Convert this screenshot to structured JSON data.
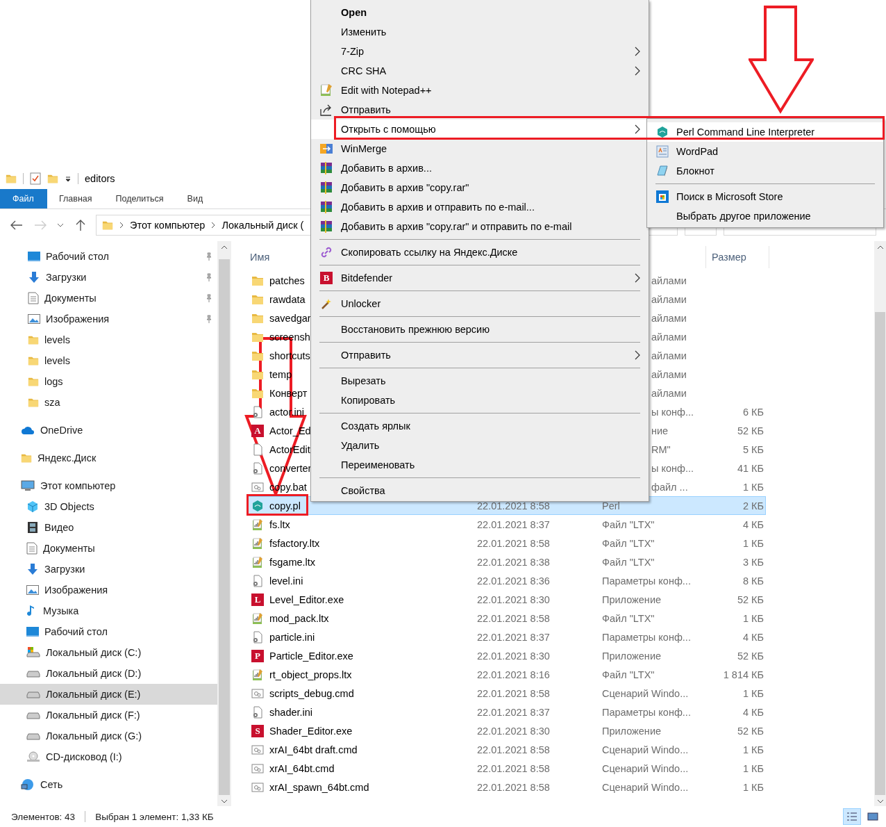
{
  "title_bar": {
    "title": "editors"
  },
  "ribbon": {
    "tabs": [
      {
        "label": "Файл",
        "kind": "file",
        "selected": false
      },
      {
        "label": "Главная",
        "kind": "tab",
        "selected": false
      },
      {
        "label": "Поделиться",
        "kind": "tab",
        "selected": false
      },
      {
        "label": "Вид",
        "kind": "tab",
        "selected": false
      }
    ]
  },
  "address": {
    "crumbs": [
      "Этот компьютер",
      "Локальный диск ("
    ]
  },
  "quick_access": [
    {
      "label": "Рабочий стол",
      "kind": "desktop",
      "pinned": true,
      "selected": false
    },
    {
      "label": "Загрузки",
      "kind": "download",
      "pinned": true,
      "selected": false
    },
    {
      "label": "Документы",
      "kind": "docs",
      "pinned": true,
      "selected": false
    },
    {
      "label": "Изображения",
      "kind": "images",
      "pinned": true,
      "selected": false
    },
    {
      "label": "levels",
      "kind": "folder",
      "pinned": false,
      "selected": false
    },
    {
      "label": "levels",
      "kind": "folder",
      "pinned": false,
      "selected": false
    },
    {
      "label": "logs",
      "kind": "folder",
      "pinned": false,
      "selected": false
    },
    {
      "label": "sza",
      "kind": "folder",
      "pinned": false,
      "selected": false
    }
  ],
  "nav": [
    {
      "label": "OneDrive",
      "kind": "cloud",
      "selected": false
    },
    {
      "label": "Яндекс.Диск",
      "kind": "folder",
      "selected": false
    },
    {
      "label": "Этот компьютер",
      "kind": "computer",
      "selected": false,
      "children": [
        {
          "label": "3D Objects",
          "kind": "cube",
          "selected": false
        },
        {
          "label": "Видео",
          "kind": "video",
          "selected": false
        },
        {
          "label": "Документы",
          "kind": "docs",
          "selected": false
        },
        {
          "label": "Загрузки",
          "kind": "download",
          "selected": false
        },
        {
          "label": "Изображения",
          "kind": "images",
          "selected": false
        },
        {
          "label": "Музыка",
          "kind": "music",
          "selected": false
        },
        {
          "label": "Рабочий стол",
          "kind": "desktop",
          "selected": false
        },
        {
          "label": "Локальный диск (C:)",
          "kind": "system-drive",
          "selected": false
        },
        {
          "label": "Локальный диск (D:)",
          "kind": "drive",
          "selected": false
        },
        {
          "label": "Локальный диск (E:)",
          "kind": "drive",
          "selected": true
        },
        {
          "label": "Локальный диск (F:)",
          "kind": "drive",
          "selected": false
        },
        {
          "label": "Локальный диск (G:)",
          "kind": "drive",
          "selected": false
        },
        {
          "label": "CD-дисковод (I:)",
          "kind": "cd",
          "selected": false
        }
      ]
    },
    {
      "label": "Сеть",
      "kind": "network",
      "selected": false
    }
  ],
  "columns": {
    "name": "Имя",
    "size": "Размер"
  },
  "files": [
    {
      "name": "patches",
      "kind": "folder",
      "type": "айлами",
      "type_clipped": true,
      "selected": false
    },
    {
      "name": "rawdata",
      "kind": "folder",
      "type": "айлами",
      "type_clipped": true,
      "selected": false
    },
    {
      "name": "savedgar",
      "kind": "folder",
      "type": "айлами",
      "type_clipped": true,
      "selected": false
    },
    {
      "name": "screensh",
      "kind": "folder",
      "type": "айлами",
      "type_clipped": true,
      "selected": false
    },
    {
      "name": "shortcuts",
      "kind": "folder",
      "type": "айлами",
      "type_clipped": true,
      "selected": false
    },
    {
      "name": "temp",
      "kind": "folder",
      "type": "айлами",
      "type_clipped": true,
      "selected": false
    },
    {
      "name": "Конверт",
      "kind": "folder",
      "type": "айлами",
      "type_clipped": true,
      "selected": false
    },
    {
      "name": "actor.ini",
      "kind": "settings",
      "type": "ы конф...",
      "type_clipped": true,
      "size": "6 КБ",
      "selected": false
    },
    {
      "name": "Actor_Ed",
      "kind": "app",
      "badge": "A",
      "type": "ние",
      "type_clipped": true,
      "size": "52 КБ",
      "selected": false
    },
    {
      "name": "ActorEdit",
      "kind": "file",
      "type": "RM\"",
      "type_clipped": true,
      "size": "5 КБ",
      "selected": false
    },
    {
      "name": "converter",
      "kind": "settings",
      "type": "ы конф...",
      "type_clipped": true,
      "size": "41 КБ",
      "selected": false
    },
    {
      "name": "copy.bat",
      "kind": "script",
      "type": "файл ...",
      "type_clipped": true,
      "size": "1 КБ",
      "selected": false
    },
    {
      "name": "copy.pl",
      "kind": "perl",
      "date": "22.01.2021 8:58",
      "type": "Perl",
      "type_clipped": false,
      "size": "2 КБ",
      "selected": true
    },
    {
      "name": "fs.ltx",
      "kind": "ltx",
      "date": "22.01.2021 8:37",
      "type": "Файл \"LTX\"",
      "type_clipped": false,
      "size": "4 КБ",
      "selected": false
    },
    {
      "name": "fsfactory.ltx",
      "kind": "ltx",
      "date": "22.01.2021 8:58",
      "type": "Файл \"LTX\"",
      "type_clipped": false,
      "size": "1 КБ",
      "selected": false
    },
    {
      "name": "fsgame.ltx",
      "kind": "ltx",
      "date": "22.01.2021 8:38",
      "type": "Файл \"LTX\"",
      "type_clipped": false,
      "size": "3 КБ",
      "selected": false
    },
    {
      "name": "level.ini",
      "kind": "settings",
      "date": "22.01.2021 8:36",
      "type": "Параметры конф...",
      "type_clipped": false,
      "size": "8 КБ",
      "selected": false
    },
    {
      "name": "Level_Editor.exe",
      "kind": "app",
      "badge": "L",
      "date": "22.01.2021 8:30",
      "type": "Приложение",
      "type_clipped": false,
      "size": "52 КБ",
      "selected": false
    },
    {
      "name": "mod_pack.ltx",
      "kind": "ltx",
      "date": "22.01.2021 8:58",
      "type": "Файл \"LTX\"",
      "type_clipped": false,
      "size": "1 КБ",
      "selected": false
    },
    {
      "name": "particle.ini",
      "kind": "settings",
      "date": "22.01.2021 8:37",
      "type": "Параметры конф...",
      "type_clipped": false,
      "size": "4 КБ",
      "selected": false
    },
    {
      "name": "Particle_Editor.exe",
      "kind": "app",
      "badge": "P",
      "date": "22.01.2021 8:30",
      "type": "Приложение",
      "type_clipped": false,
      "size": "52 КБ",
      "selected": false
    },
    {
      "name": "rt_object_props.ltx",
      "kind": "ltx",
      "date": "22.01.2021 8:16",
      "type": "Файл \"LTX\"",
      "type_clipped": false,
      "size": "1 814 КБ",
      "selected": false
    },
    {
      "name": "scripts_debug.cmd",
      "kind": "script",
      "date": "22.01.2021 8:58",
      "type": "Сценарий Windo...",
      "type_clipped": false,
      "size": "1 КБ",
      "selected": false
    },
    {
      "name": "shader.ini",
      "kind": "settings",
      "date": "22.01.2021 8:37",
      "type": "Параметры конф...",
      "type_clipped": false,
      "size": "4 КБ",
      "selected": false
    },
    {
      "name": "Shader_Editor.exe",
      "kind": "app",
      "badge": "S",
      "date": "22.01.2021 8:30",
      "type": "Приложение",
      "type_clipped": false,
      "size": "52 КБ",
      "selected": false
    },
    {
      "name": "xrAI_64bt draft.cmd",
      "kind": "script",
      "date": "22.01.2021 8:58",
      "type": "Сценарий Windo...",
      "type_clipped": false,
      "size": "1 КБ",
      "selected": false
    },
    {
      "name": "xrAI_64bt.cmd",
      "kind": "script",
      "date": "22.01.2021 8:58",
      "type": "Сценарий Windo...",
      "type_clipped": false,
      "size": "1 КБ",
      "selected": false
    },
    {
      "name": "xrAI_spawn_64bt.cmd",
      "kind": "script",
      "date": "22.01.2021 8:58",
      "type": "Сценарий Windo...",
      "type_clipped": false,
      "size": "1 КБ",
      "selected": false
    }
  ],
  "status_bar": {
    "count": "Элементов: 43",
    "selection": "Выбран 1 элемент: 1,33 КБ",
    "views": [
      {
        "kind": "details",
        "selected": true
      },
      {
        "kind": "tiles",
        "selected": false
      }
    ]
  },
  "context_menu": {
    "items": [
      {
        "kind": "item",
        "label": "Open",
        "default": true,
        "submenu": false,
        "selected": false
      },
      {
        "kind": "item",
        "label": "Изменить",
        "default": false,
        "submenu": false,
        "selected": false
      },
      {
        "kind": "item",
        "label": "7-Zip",
        "default": false,
        "submenu": true,
        "selected": false
      },
      {
        "kind": "item",
        "label": "CRC SHA",
        "default": false,
        "submenu": true,
        "selected": false
      },
      {
        "kind": "item",
        "label": "Edit with Notepad++",
        "default": false,
        "submenu": false,
        "selected": false
      },
      {
        "kind": "item",
        "label": "Отправить",
        "default": false,
        "submenu": false,
        "selected": false
      },
      {
        "kind": "item",
        "label": "Открыть с помощью",
        "default": false,
        "submenu": true,
        "selected": true
      },
      {
        "kind": "item",
        "label": "WinMerge",
        "default": false,
        "submenu": false,
        "selected": false
      },
      {
        "kind": "item",
        "label": "Добавить в архив...",
        "default": false,
        "submenu": false,
        "selected": false
      },
      {
        "kind": "item",
        "label": "Добавить в архив \"copy.rar\"",
        "default": false,
        "submenu": false,
        "selected": false
      },
      {
        "kind": "item",
        "label": "Добавить в архив и отправить по e-mail...",
        "default": false,
        "submenu": false,
        "selected": false
      },
      {
        "kind": "item",
        "label": "Добавить в архив \"copy.rar\" и отправить по e-mail",
        "default": false,
        "submenu": false,
        "selected": false
      },
      {
        "kind": "separator"
      },
      {
        "kind": "item",
        "label": "Скопировать ссылку на Яндекс.Диске",
        "default": false,
        "submenu": false,
        "selected": false
      },
      {
        "kind": "separator"
      },
      {
        "kind": "item",
        "label": "Bitdefender",
        "badge": "B",
        "default": false,
        "submenu": true,
        "selected": false
      },
      {
        "kind": "separator"
      },
      {
        "kind": "item",
        "label": "Unlocker",
        "default": false,
        "submenu": false,
        "selected": false
      },
      {
        "kind": "separator"
      },
      {
        "kind": "item",
        "label": "Восстановить прежнюю версию",
        "default": false,
        "submenu": false,
        "selected": false
      },
      {
        "kind": "separator"
      },
      {
        "kind": "item",
        "label": "Отправить",
        "default": false,
        "submenu": true,
        "selected": false
      },
      {
        "kind": "separator"
      },
      {
        "kind": "item",
        "label": "Вырезать",
        "default": false,
        "submenu": false,
        "selected": false
      },
      {
        "kind": "item",
        "label": "Копировать",
        "default": false,
        "submenu": false,
        "selected": false
      },
      {
        "kind": "separator"
      },
      {
        "kind": "item",
        "label": "Создать ярлык",
        "default": false,
        "submenu": false,
        "selected": false
      },
      {
        "kind": "item",
        "label": "Удалить",
        "default": false,
        "submenu": false,
        "selected": false
      },
      {
        "kind": "item",
        "label": "Переименовать",
        "default": false,
        "submenu": false,
        "selected": false
      },
      {
        "kind": "separator"
      },
      {
        "kind": "item",
        "label": "Свойства",
        "default": false,
        "submenu": false,
        "selected": false
      }
    ]
  },
  "submenu": {
    "items": [
      {
        "kind": "item",
        "label": "Perl Command Line Interpreter",
        "selected": true
      },
      {
        "kind": "item",
        "label": "WordPad",
        "selected": false
      },
      {
        "kind": "item",
        "label": "Блокнот",
        "selected": false
      },
      {
        "kind": "separator"
      },
      {
        "kind": "item",
        "label": "Поиск в Microsoft Store",
        "selected": false
      },
      {
        "kind": "item",
        "label": "Выбрать другое приложение",
        "selected": false
      }
    ]
  }
}
